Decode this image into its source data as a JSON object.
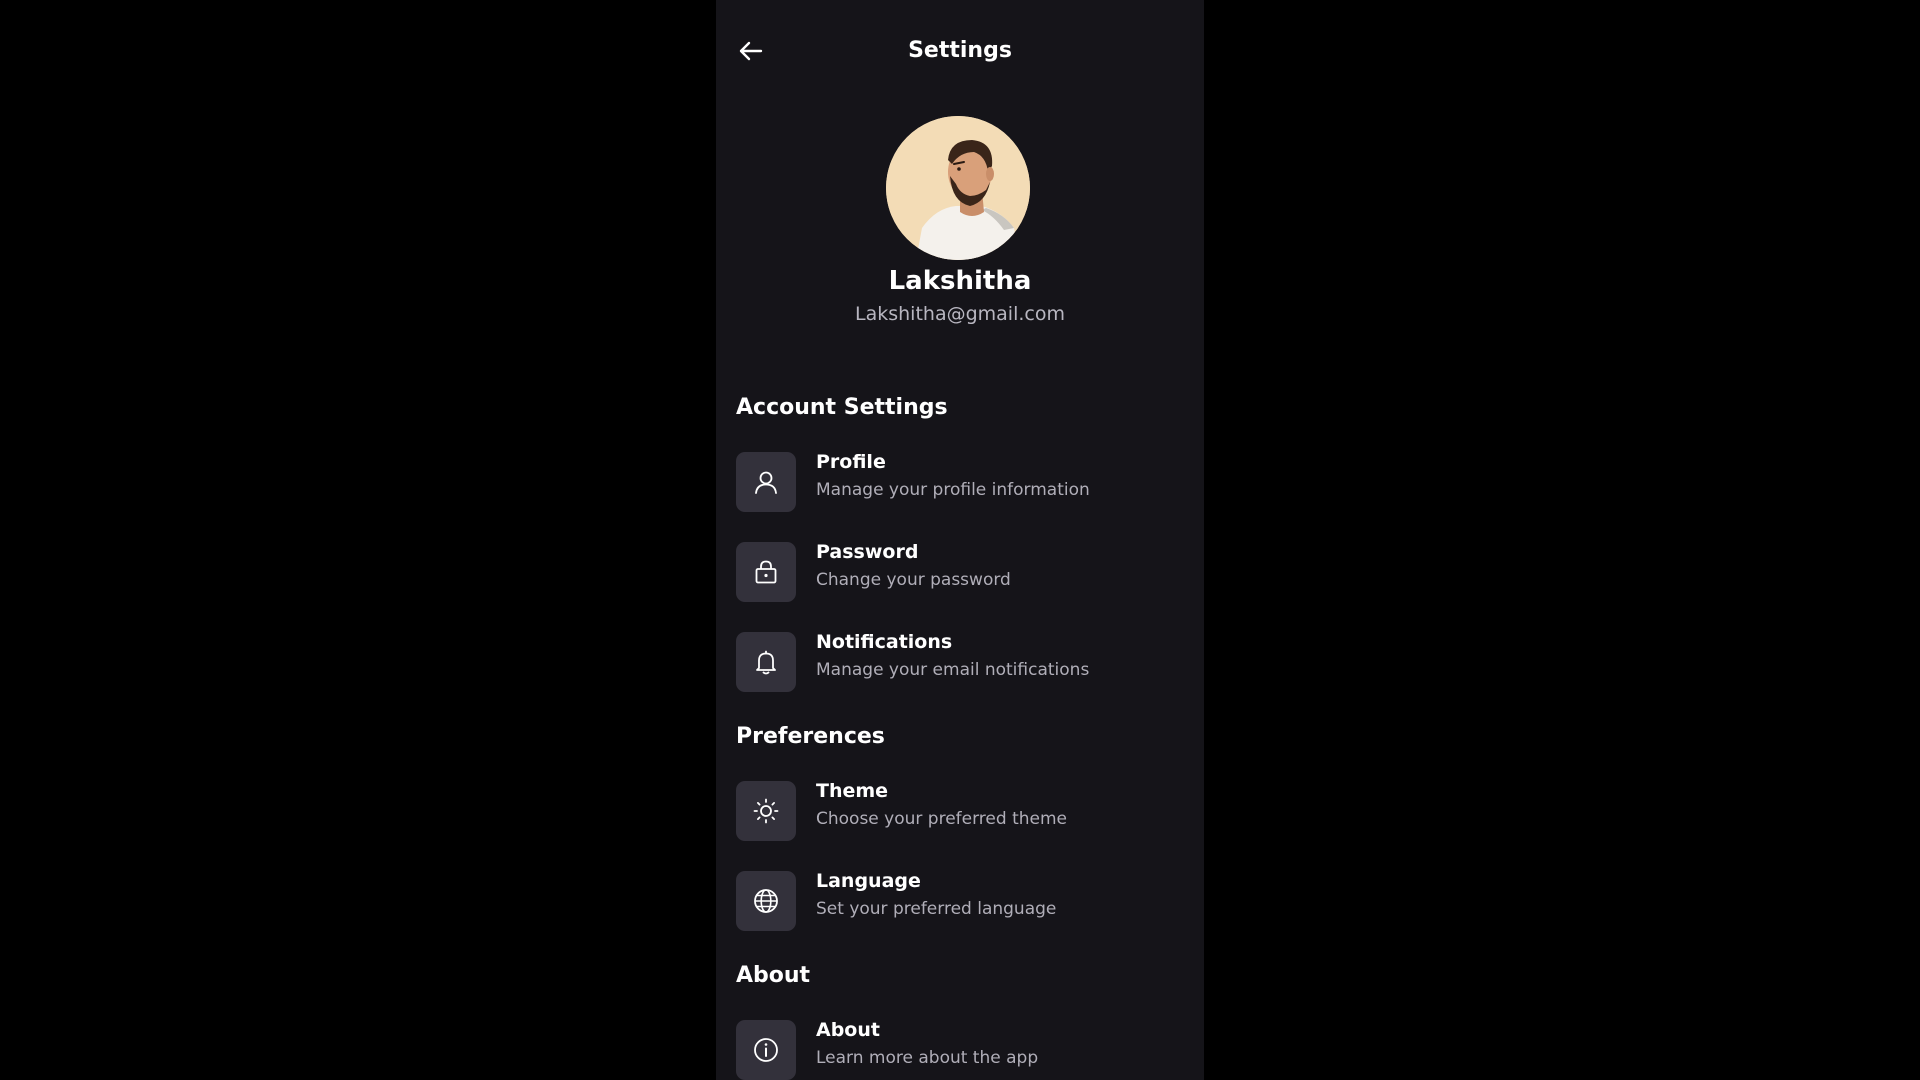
{
  "header": {
    "title": "Settings",
    "back_icon": "arrow-left-icon"
  },
  "user": {
    "name": "Lakshitha",
    "email": "Lakshitha@gmail.com",
    "avatar_icon": "avatar-illustration"
  },
  "sections": {
    "account": {
      "title": "Account Settings",
      "items": [
        {
          "title": "Profile",
          "subtitle": "Manage your profile information",
          "icon": "user-icon"
        },
        {
          "title": "Password",
          "subtitle": "Change your password",
          "icon": "lock-icon"
        },
        {
          "title": "Notifications",
          "subtitle": "Manage your email notifications",
          "icon": "bell-icon"
        }
      ]
    },
    "preferences": {
      "title": "Preferences",
      "items": [
        {
          "title": "Theme",
          "subtitle": "Choose your preferred theme",
          "icon": "sun-icon"
        },
        {
          "title": "Language",
          "subtitle": "Set your preferred language",
          "icon": "globe-icon"
        }
      ]
    },
    "about": {
      "title": "About",
      "items": [
        {
          "title": "About",
          "subtitle": "Learn more about the app",
          "icon": "info-icon"
        }
      ]
    }
  },
  "colors": {
    "page_background": "#000000",
    "screen_background": "#151419",
    "icon_tile": "#33313b",
    "text_primary": "#ffffff",
    "text_secondary": "#b0aeb8",
    "avatar_background": "#f3dcb6"
  }
}
